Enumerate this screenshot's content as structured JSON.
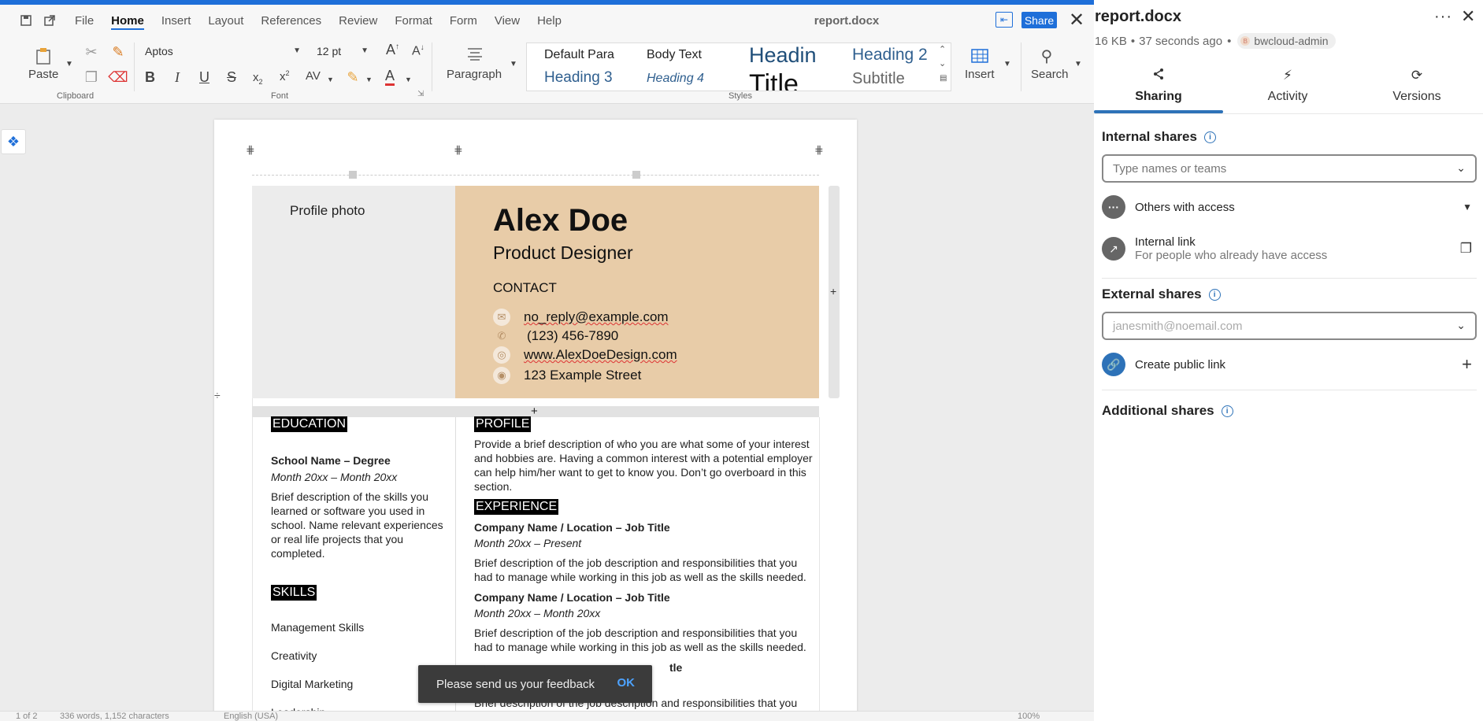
{
  "menubar": {
    "items": [
      "File",
      "Home",
      "Insert",
      "Layout",
      "References",
      "Review",
      "Format",
      "Form",
      "View",
      "Help"
    ],
    "active": "Home",
    "doc_title": "report.docx",
    "share_label": "Share"
  },
  "ribbon": {
    "paste_label": "Paste",
    "clipboard_label": "Clipboard",
    "font_name": "Aptos",
    "font_size": "12 pt",
    "font_label": "Font",
    "paragraph_label": "Paragraph",
    "styles": [
      "Default Para",
      "Body Text",
      "Headin",
      "Heading 2",
      "Heading 3",
      "Heading 4",
      "Title",
      "Subtitle"
    ],
    "styles_label": "Styles",
    "insert_label": "Insert",
    "search_label": "Search"
  },
  "document": {
    "photo_label": "Profile photo",
    "name": "Alex Doe",
    "role": "Product Designer",
    "contact_heading": "CONTACT",
    "contact": [
      {
        "icon": "mail-icon",
        "text": "no_reply@example.com"
      },
      {
        "icon": "phone-icon",
        "text": "(123) 456-7890"
      },
      {
        "icon": "globe-icon",
        "text": "www.AlexDoeDesign.com"
      },
      {
        "icon": "location-icon",
        "text": "123 Example Street"
      }
    ],
    "education_title": "EDUCATION",
    "school": "School Name – Degree",
    "school_dates": "Month 20xx – Month 20xx",
    "school_desc": "Brief description of the skills you learned or software you used in school. Name relevant experiences or real life projects that you completed.",
    "skills_title": "SKILLS",
    "skills": [
      "Management Skills",
      "Creativity",
      "Digital Marketing",
      "Leadership"
    ],
    "profile_title": "PROFILE",
    "profile_desc": "Provide a brief description of who you are what some of your interest and hobbies are. Having a common interest with a potential employer can help him/her want to get to know you. Don’t go overboard in this section.",
    "experience_title": "EXPERIENCE",
    "jobs": [
      {
        "title": "Company Name / Location – Job Title",
        "dates": "Month 20xx – Present",
        "desc": "Brief description of the job description and responsibilities that you had to manage while working in this job as well as the skills needed."
      },
      {
        "title": "Company Name / Location – Job Title",
        "dates": "Month 20xx – Month 20xx",
        "desc": "Brief description of the job description and responsibilities that you had to manage while working in this job as well as the skills needed."
      },
      {
        "title": "tle",
        "desc": "Brief description of the job description and responsibilities that you"
      }
    ]
  },
  "toast": {
    "text": "Please send us your feedback",
    "ok": "OK"
  },
  "statusbar": {
    "page": "1 of 2",
    "words": "336 words, 1,152 characters",
    "language": "English (USA)",
    "zoom": "100%"
  },
  "panel": {
    "title": "report.docx",
    "size": "16 KB",
    "modified": "37 seconds ago",
    "owner": "bwcloud-admin",
    "owner_initial": "B",
    "tabs": [
      {
        "label": "Sharing",
        "icon": "share-icon"
      },
      {
        "label": "Activity",
        "icon": "bolt-icon"
      },
      {
        "label": "Versions",
        "icon": "history-icon"
      }
    ],
    "internal_title": "Internal shares",
    "internal_placeholder": "Type names or teams",
    "others_access": "Others with access",
    "internal_link": "Internal link",
    "internal_link_sub": "For people who already have access",
    "external_title": "External shares",
    "external_placeholder": "janesmith@noemail.com",
    "public_link": "Create public link",
    "additional_title": "Additional shares"
  },
  "colors": {
    "accent": "#1e6fd9",
    "panel_accent": "#2d72b8",
    "name_cell": "#e8cca8",
    "photo_cell": "#ececec"
  }
}
